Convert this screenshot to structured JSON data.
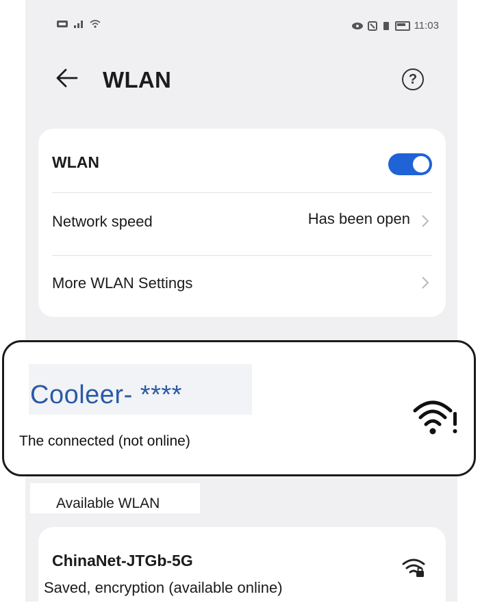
{
  "status_bar": {
    "time": "11:03"
  },
  "header": {
    "title": "WLAN",
    "back_icon": "arrow-left-icon",
    "help_icon": "help-icon"
  },
  "settings": {
    "wlan_label": "WLAN",
    "wlan_enabled": true,
    "network_speed_label": "Network speed",
    "network_speed_value": "Has been open",
    "more_settings_label": "More WLAN Settings"
  },
  "connected": {
    "ssid": "Cooleer- ****",
    "status": "The connected (not online)",
    "icon": "wifi-alert-icon"
  },
  "available": {
    "section_label": "Available WLAN",
    "networks": [
      {
        "name": "ChinaNet-JTGb-5G",
        "status": "Saved, encryption (available online)",
        "icon": "wifi-lock-icon"
      }
    ]
  },
  "colors": {
    "accent": "#1f63d6",
    "ssid_text": "#2b5aa6",
    "background": "#f0f0f2"
  }
}
